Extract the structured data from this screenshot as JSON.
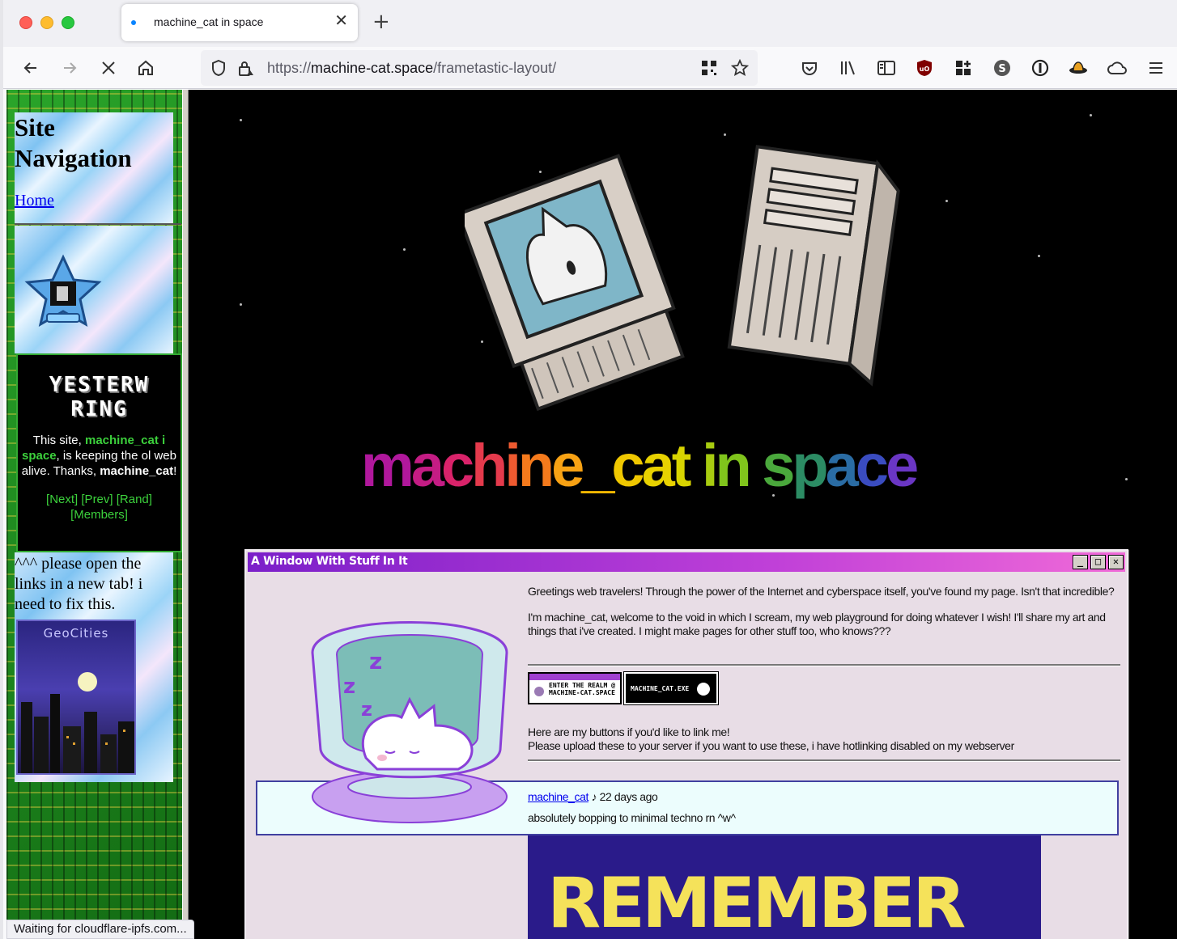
{
  "browser": {
    "tab_title": "machine_cat in space",
    "new_tab_symbol": "+",
    "tab_close_symbol": "✕",
    "url_scheme": "https://",
    "url_host": "machine-cat.space",
    "url_path": "/frametastic-layout/",
    "status_text": "Waiting for cloudflare-ipfs.com...",
    "icons": [
      "back-icon",
      "forward-icon",
      "stop-icon",
      "home-icon",
      "shield-icon",
      "lock-icon",
      "qr-icon",
      "bookmark-star-icon",
      "pocket-icon",
      "library-icon",
      "sidebar-icon",
      "ublock-icon",
      "extensions-icon",
      "sync-s-icon",
      "onepassword-icon",
      "hat-icon",
      "cloud-icon",
      "menu-icon"
    ]
  },
  "left_frame": {
    "nav_heading": "Site Navigation",
    "nav_home_link": "Home",
    "ring_title_line1": "YESTERW",
    "ring_title_line2": "RING",
    "ring_text_prefix": "This site, ",
    "ring_text_site": "machine_cat i space",
    "ring_text_middle": ", is keeping the ol web alive. Thanks, ",
    "ring_text_name": "machine_cat",
    "ring_text_suffix": "!",
    "ring_links": "[Next] [Prev] [Rand] [Members]",
    "note": "^^^ please open the links in a new tab! i need to fix this.",
    "geocities_label": "GeoCities"
  },
  "main_frame": {
    "site_title_letters": [
      "m",
      "a",
      "c",
      "h",
      "i",
      "n",
      "e",
      "_",
      "c",
      "a",
      "t",
      " ",
      "i",
      "n",
      " ",
      "s",
      "p",
      "a",
      "c",
      "e"
    ],
    "site_title_colors": [
      "#b0189c",
      "#c41c84",
      "#d9236a",
      "#e43a4c",
      "#ee5a30",
      "#f57a1c",
      "#f8a214",
      "#f5b800",
      "#f0c800",
      "#e8d200",
      "#d8d400",
      "#ffffff",
      "#a8cc10",
      "#80c41c",
      "#ffffff",
      "#4aa83c",
      "#2c8c64",
      "#2a6ca4",
      "#3a4cc0",
      "#6a36c4"
    ],
    "window": {
      "title": "A Window With Stuff In It",
      "minimize_symbol": "_",
      "maximize_symbol": "□",
      "close_symbol": "✕",
      "intro_p1": "Greetings web travelers! Through the power of the Internet and cyberspace itself, you've found my page. Isn't that incredible?",
      "intro_p2": "I'm machine_cat, welcome to the void in which I scream, my web playground for doing whatever I wish! I'll share my art and things that i've created. I might make pages for other stuff too, who knows???",
      "button1_text": "ENTER THE REALM @ MACHINE-CAT.SPACE",
      "button2_text": "MACHINE_CAT.EXE",
      "buttons_line1": "Here are my buttons if you'd like to link me!",
      "buttons_line2": "Please upload these to your server if you want to use these, i have hotlinking disabled on my webserver",
      "status_user": "machine_cat",
      "status_meta": " ♪ 22 days ago",
      "status_message": "absolutely bopping to minimal techno rn ^w^",
      "remember_text": "REMEMBER"
    }
  }
}
